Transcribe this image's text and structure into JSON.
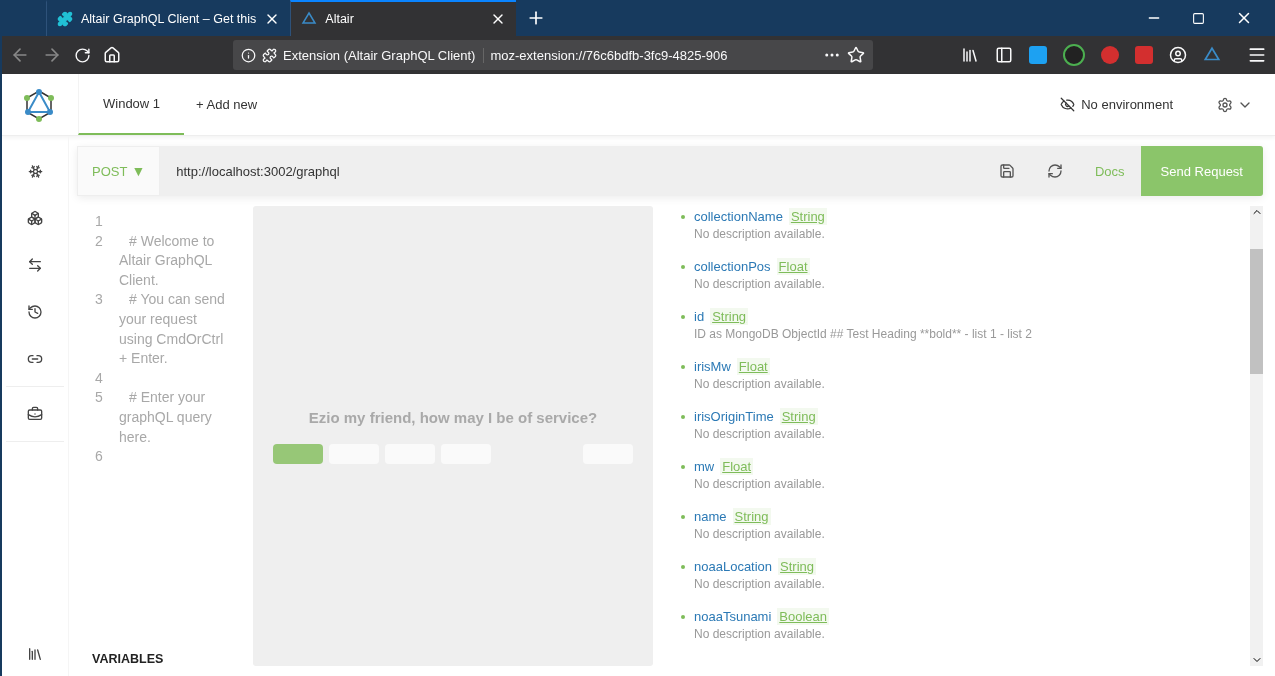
{
  "browser": {
    "tabs": [
      {
        "title": "Altair GraphQL Client – Get this",
        "selected": false
      },
      {
        "title": "Altair",
        "selected": true
      }
    ],
    "address": {
      "identity": "Extension (Altair GraphQL Client)",
      "url": "moz-extension://76c6bdfb-3fc9-4825-906"
    }
  },
  "app": {
    "windows": [
      {
        "label": "Window 1",
        "selected": true
      }
    ],
    "add_window": "+ Add new",
    "environment": "No environment"
  },
  "request": {
    "method": "POST",
    "method_caret": "▼",
    "url": "http://localhost:3002/graphql",
    "docs": "Docs",
    "send": "Send Request"
  },
  "editor": {
    "lines": [
      {
        "number": "1"
      },
      {
        "number": "2",
        "text": "# Welcome to Altair GraphQL Client."
      },
      {
        "number": "3",
        "text": "# You can send your request using CmdOrCtrl + Enter."
      },
      {
        "number": "4"
      },
      {
        "number": "5",
        "text": "# Enter your graphQL query here."
      },
      {
        "number": "6"
      }
    ],
    "variables_title": "VARIABLES"
  },
  "result": {
    "greeting": "Ezio my friend, how may I be of service?",
    "placeholders": [
      {
        "selected": true
      },
      {
        "selected": false
      },
      {
        "selected": false
      },
      {
        "selected": false
      },
      {
        "selected": false
      }
    ]
  },
  "docs": {
    "fields": [
      {
        "name": "collectionName",
        "type": "String",
        "description": "No description available."
      },
      {
        "name": "collectionPos",
        "type": "Float",
        "description": "No description available."
      },
      {
        "name": "id",
        "type": "String",
        "description": "ID as MongoDB ObjectId ## Test Heading **bold** - list 1 - list 2"
      },
      {
        "name": "irisMw",
        "type": "Float",
        "description": "No description available."
      },
      {
        "name": "irisOriginTime",
        "type": "String",
        "description": "No description available."
      },
      {
        "name": "mw",
        "type": "Float",
        "description": "No description available."
      },
      {
        "name": "name",
        "type": "String",
        "description": "No description available."
      },
      {
        "name": "noaaLocation",
        "type": "String",
        "description": "No description available."
      },
      {
        "name": "noaaTsunami",
        "type": "Boolean",
        "description": "No description available."
      }
    ]
  }
}
